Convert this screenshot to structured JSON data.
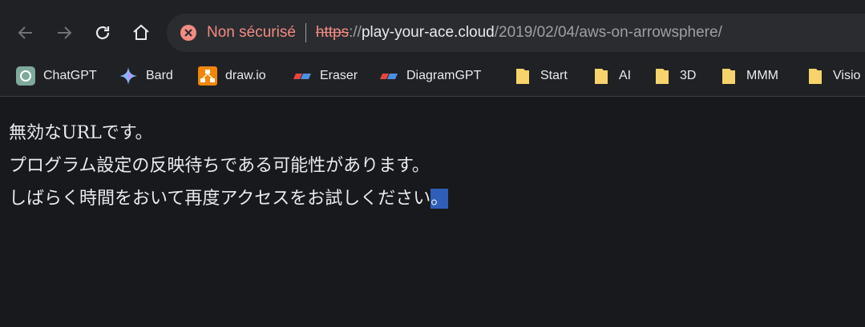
{
  "browser": {
    "security_label": "Non sécurisé",
    "url": {
      "scheme": "https",
      "separator": "://",
      "host": "play-your-ace.cloud",
      "path": "/2019/02/04/aws-on-arrowsphere/"
    },
    "icons": [
      "back-arrow-icon",
      "forward-arrow-icon",
      "reload-icon",
      "home-icon",
      "not-secure-icon"
    ]
  },
  "bookmarks": [
    {
      "label": "ChatGPT",
      "icon": "chatgpt-icon"
    },
    {
      "label": "Bard",
      "icon": "bard-sparkle-icon"
    },
    {
      "label": "draw.io",
      "icon": "drawio-icon"
    },
    {
      "label": "Eraser",
      "icon": "eraser-icon"
    },
    {
      "label": "DiagramGPT",
      "icon": "diagramgpt-icon"
    },
    {
      "label": "Start",
      "icon": "folder-icon"
    },
    {
      "label": "AI",
      "icon": "folder-icon"
    },
    {
      "label": "3D",
      "icon": "folder-icon"
    },
    {
      "label": "MMM",
      "icon": "folder-icon"
    },
    {
      "label": "Visio",
      "icon": "folder-icon"
    }
  ],
  "page": {
    "line1": "無効なURLです。",
    "line2": "プログラム設定の反映待ちである可能性があります。",
    "line3_main": "しばらく時間をおいて再度アクセスをお試しください",
    "line3_selected": "。"
  },
  "colors": {
    "toolbar_bg": "#202124",
    "page_bg": "#18191c",
    "warning": "#f28b82",
    "selection": "#2e5fb8"
  }
}
